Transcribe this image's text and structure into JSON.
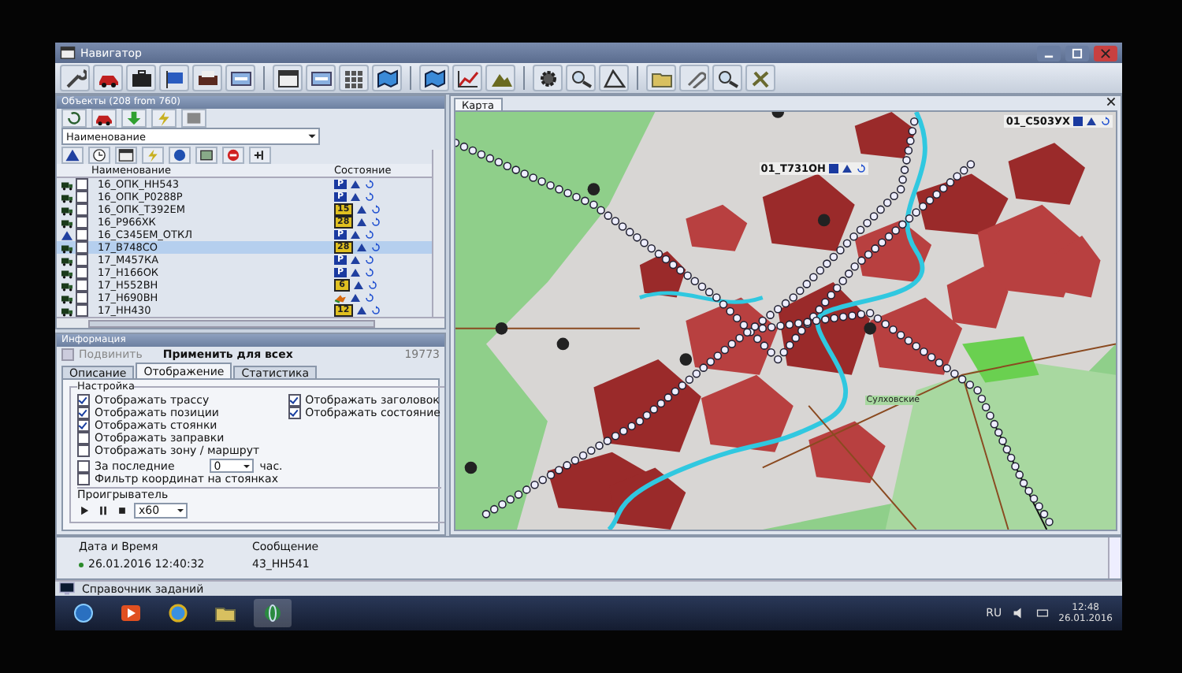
{
  "window": {
    "title": "Навигатор"
  },
  "objects_panel": {
    "title": "Объекты (208 from 760)",
    "sort_field": "Наименование",
    "columns": {
      "name": "Наименование",
      "state": "Состояние"
    },
    "rows": [
      {
        "kind": "truck",
        "checked": false,
        "name": "16_ОПК_НН543",
        "badge": {
          "kind": "parking",
          "text": "P"
        },
        "selected": false
      },
      {
        "kind": "truck",
        "checked": false,
        "name": "16_ОПК_Р0288Р",
        "badge": {
          "kind": "parking",
          "text": "P"
        },
        "selected": false
      },
      {
        "kind": "truck",
        "checked": false,
        "name": "16_ОПК_Т392ЕМ",
        "badge": {
          "kind": "number",
          "text": "15"
        },
        "selected": false
      },
      {
        "kind": "truck",
        "checked": false,
        "name": "16_Р966ХК",
        "badge": {
          "kind": "number",
          "text": "28"
        },
        "selected": false
      },
      {
        "kind": "marker",
        "checked": false,
        "name": "16_С345ЕМ_ОТКЛ",
        "badge": {
          "kind": "parking",
          "text": "P"
        },
        "selected": false
      },
      {
        "kind": "truck",
        "checked": false,
        "name": "17_В748СО",
        "badge": {
          "kind": "number",
          "text": "28"
        },
        "selected": true
      },
      {
        "kind": "truck",
        "checked": false,
        "name": "17_М457КА",
        "badge": {
          "kind": "parking",
          "text": "P"
        },
        "selected": false
      },
      {
        "kind": "truck",
        "checked": false,
        "name": "17_Н166ОК",
        "badge": {
          "kind": "parking",
          "text": "P"
        },
        "selected": false
      },
      {
        "kind": "truck",
        "checked": false,
        "name": "17_Н552ВН",
        "badge": {
          "kind": "number",
          "text": "6"
        },
        "selected": false
      },
      {
        "kind": "truck",
        "checked": false,
        "name": "17_Н690ВН",
        "badge": {
          "kind": "moving"
        },
        "selected": false
      },
      {
        "kind": "truck",
        "checked": false,
        "name": "17_НН430",
        "badge": {
          "kind": "number",
          "text": "12"
        },
        "selected": false
      }
    ]
  },
  "info_panel": {
    "title": "Информация",
    "pin": {
      "label": "Подвинить",
      "disabled": true
    },
    "apply_label": "Применить для всех",
    "counter": "19773",
    "tabs": [
      {
        "label": "Описание",
        "selected": false
      },
      {
        "label": "Отображение",
        "selected": true
      },
      {
        "label": "Статистика",
        "selected": false
      }
    ],
    "settings": {
      "title": "Настройка",
      "left_options": [
        {
          "label": "Отображать трассу",
          "checked": true
        },
        {
          "label": "Отображать позиции",
          "checked": true
        },
        {
          "label": "Отображать стоянки",
          "checked": true
        },
        {
          "label": "Отображать заправки",
          "checked": false
        },
        {
          "label": "Отображать зону / маршрут",
          "checked": false
        }
      ],
      "right_options": [
        {
          "label": "Отображать заголовок",
          "checked": true
        },
        {
          "label": "Отображать состояние",
          "checked": true
        }
      ],
      "period": {
        "label": "За последние",
        "checked": false,
        "value": "0",
        "unit": "час."
      },
      "filter": {
        "label": "Фильтр координат на стоянках",
        "checked": false
      }
    },
    "player": {
      "title": "Проигрыватель",
      "speed": "x60"
    }
  },
  "map_panel": {
    "tab": "Карта",
    "vehicle_labels": [
      {
        "text": "01_С503УХ"
      },
      {
        "text": "01_Т731ОН"
      }
    ],
    "place_label": "Сулховские"
  },
  "log": {
    "columns": [
      "Дата и Время",
      "Сообщение"
    ],
    "rows": [
      {
        "time": "26.01.2016 12:40:32",
        "message": "43_НН541"
      }
    ]
  },
  "status_bar": {
    "text": "Справочник заданий"
  },
  "taskbar": {
    "language": "RU",
    "time": "12:48",
    "date": "26.01.2016"
  }
}
